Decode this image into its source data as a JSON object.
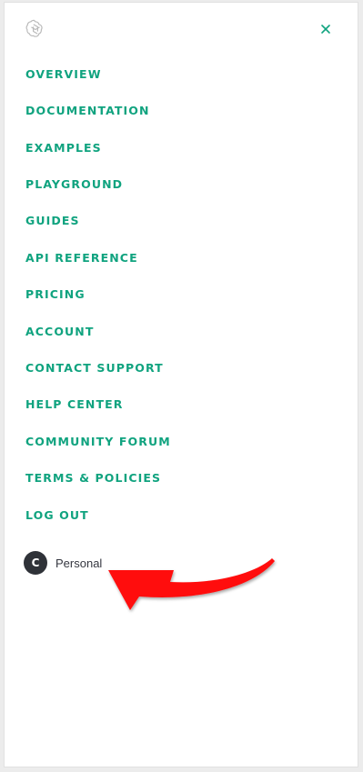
{
  "header": {
    "logo_icon": "openai-logo-icon",
    "close_icon": "close-icon",
    "accent_color": "#10a37f"
  },
  "nav": {
    "items": [
      {
        "label": "OVERVIEW"
      },
      {
        "label": "DOCUMENTATION"
      },
      {
        "label": "EXAMPLES"
      },
      {
        "label": "PLAYGROUND"
      },
      {
        "label": "GUIDES"
      },
      {
        "label": "API REFERENCE"
      },
      {
        "label": "PRICING"
      },
      {
        "label": "ACCOUNT"
      },
      {
        "label": "CONTACT SUPPORT"
      },
      {
        "label": "HELP CENTER"
      },
      {
        "label": "COMMUNITY FORUM"
      },
      {
        "label": "TERMS & POLICIES"
      },
      {
        "label": "LOG OUT"
      }
    ]
  },
  "account": {
    "avatar_initial": "C",
    "label": "Personal"
  },
  "annotation": {
    "arrow_icon": "red-arrow-icon",
    "color": "#ff0000"
  }
}
